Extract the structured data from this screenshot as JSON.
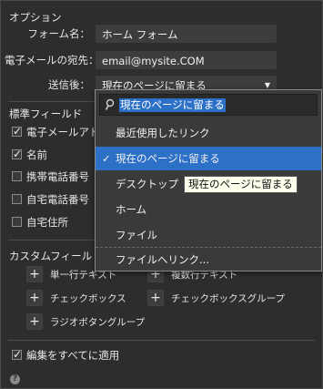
{
  "options": {
    "title": "オプション",
    "form_name_label": "フォーム名：",
    "form_name_value": "ホーム フォーム",
    "email_label": "電子メールの宛先：",
    "email_value": "email@mysite.COM",
    "after_send_label": "送信後：",
    "after_send_value": "現在のページに留まる"
  },
  "standard_fields": {
    "title": "標準フィールド",
    "items": [
      {
        "label": "電子メールアドレス",
        "checked": true
      },
      {
        "label": "名前",
        "checked": true
      },
      {
        "label": "携帯電話番号",
        "checked": false
      },
      {
        "label": "自宅電話番号",
        "checked": false
      },
      {
        "label": "自宅住所",
        "checked": false
      }
    ]
  },
  "custom_fields": {
    "title": "カスタムフィールドを追加",
    "buttons": [
      "単一行テキスト",
      "複数行テキスト",
      "チェックボックス",
      "チェックボックスグループ",
      "ラジオボタングループ"
    ]
  },
  "apply_all": {
    "label": "編集をすべてに適用",
    "checked": true
  },
  "help_icon": "?",
  "dropdown": {
    "search_value": "現在のページに留まる",
    "items": [
      "最近使用したリンク",
      "現在のページに留まる",
      "デスクトップ",
      "ホーム",
      "ファイル",
      "ファイルへリンク..."
    ],
    "selected_index": 1,
    "check_mark": "✓"
  },
  "tooltip": "現在のページに留まる"
}
